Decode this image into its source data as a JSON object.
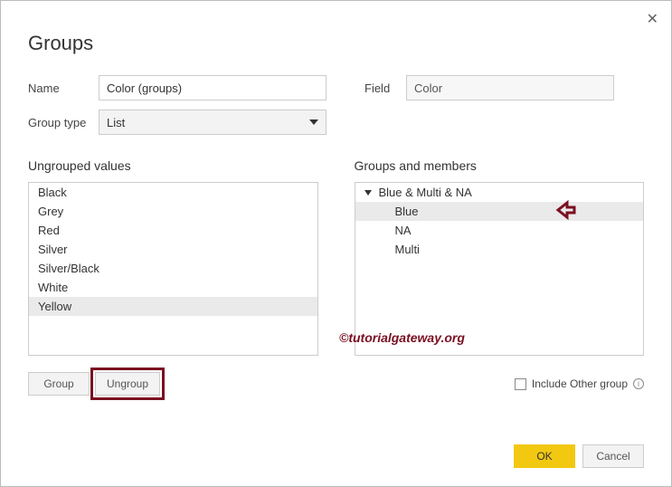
{
  "dialog": {
    "title": "Groups",
    "name_label": "Name",
    "name_value": "Color (groups)",
    "field_label": "Field",
    "field_value": "Color",
    "group_type_label": "Group type",
    "group_type_value": "List"
  },
  "left": {
    "header": "Ungrouped values",
    "items": [
      "Black",
      "Grey",
      "Red",
      "Silver",
      "Silver/Black",
      "White",
      "Yellow"
    ],
    "selected_index": 6
  },
  "right": {
    "header": "Groups and members",
    "group_name": "Blue & Multi & NA",
    "members": [
      "Blue",
      "NA",
      "Multi"
    ],
    "selected_index": 0
  },
  "buttons": {
    "group": "Group",
    "ungroup": "Ungroup",
    "include_other": "Include Other group",
    "ok": "OK",
    "cancel": "Cancel"
  },
  "watermark": "©tutorialgateway.org"
}
